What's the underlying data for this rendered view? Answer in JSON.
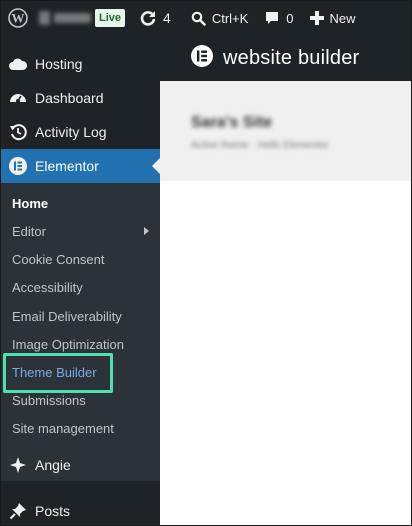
{
  "adminbar": {
    "live_badge": "Live",
    "updates_count": "4",
    "search_shortcut": "Ctrl+K",
    "comments_count": "0",
    "new_label": "New"
  },
  "sidebar": {
    "items": [
      {
        "label": "Hosting",
        "icon": "cloud-icon"
      },
      {
        "label": "Dashboard",
        "icon": "gauge-icon"
      },
      {
        "label": "Activity Log",
        "icon": "history-icon"
      },
      {
        "label": "Elementor",
        "icon": "elementor-icon",
        "active": true
      },
      {
        "label": "Angie",
        "icon": "angie-icon"
      },
      {
        "label": "Posts",
        "icon": "pin-icon"
      }
    ],
    "submenu": [
      "Home",
      "Editor",
      "Cookie Consent",
      "Accessibility",
      "Email Deliverability",
      "Image Optimization",
      "Theme Builder",
      "Submissions",
      "Site management"
    ]
  },
  "main": {
    "header_title": "website builder",
    "site_title": "Sara's Site",
    "site_subtitle": "Active theme · Hello Elementor"
  },
  "colors": {
    "admin_bg": "#1d2327",
    "submenu_bg": "#2c3338",
    "active_blue": "#2271b1",
    "highlight": "#4fe0b0",
    "link_blue": "#72aee6"
  }
}
